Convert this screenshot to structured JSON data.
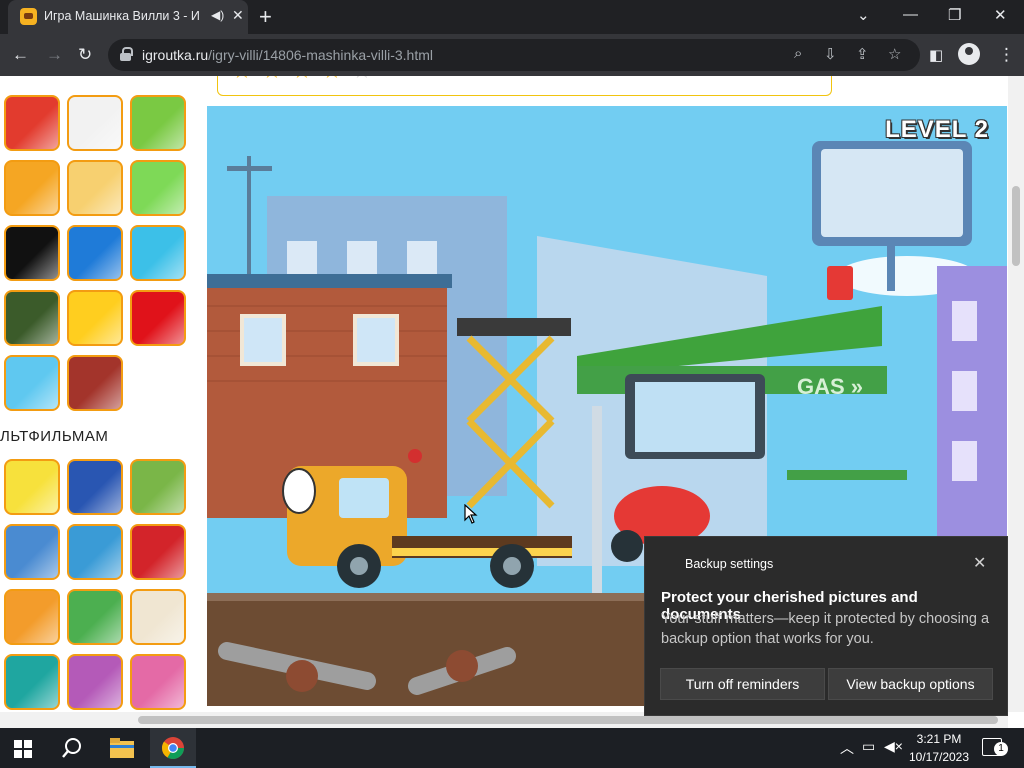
{
  "browser": {
    "tab_title": "Игра Машинка Вилли 3 - И",
    "tab_audio_icon": "speaker-icon",
    "new_tab_label": "+",
    "url_host": "igroutka.ru",
    "url_path": "/igry-villi/14806-mashinka-villi-3.html",
    "window_controls": [
      "tab-search",
      "minimize",
      "restore",
      "close"
    ]
  },
  "sidebar": {
    "section_title": "ЛЬТФИЛЬМАМ",
    "thumbnails_top": [
      {
        "name": "angry-birds",
        "color": "#e23b2e"
      },
      {
        "name": "panda",
        "color": "#f2f2f2"
      },
      {
        "name": "cut-the-rope",
        "color": "#7ac943"
      },
      {
        "name": "chef-hand",
        "color": "#f5a623"
      },
      {
        "name": "adam-and-eve",
        "color": "#f7d070"
      },
      {
        "name": "wheely-car",
        "color": "#7ed957"
      },
      {
        "name": "cartoon-network",
        "color": "#111111"
      },
      {
        "name": "disney-channel",
        "color": "#1f7bd8"
      },
      {
        "name": "gem-match",
        "color": "#3cc0e8"
      },
      {
        "name": "army-soldier",
        "color": "#3b5b2a"
      },
      {
        "name": "brawl-stars",
        "color": "#ffce1f"
      },
      {
        "name": "among-us",
        "color": "#e0121a"
      },
      {
        "name": "pop-it",
        "color": "#5fc8f0"
      },
      {
        "name": "angry-bird-red",
        "color": "#a3342b"
      }
    ],
    "thumbnails_bottom": [
      {
        "name": "spongebob",
        "color": "#f7e13c"
      },
      {
        "name": "sonic",
        "color": "#2956b2"
      },
      {
        "name": "paw-patrol",
        "color": "#7ab648"
      },
      {
        "name": "gravity-falls",
        "color": "#4a8bd1"
      },
      {
        "name": "tom-and-jerry",
        "color": "#3a9bd6"
      },
      {
        "name": "cars-mcqueen",
        "color": "#d3242a"
      },
      {
        "name": "naruto",
        "color": "#f39c2b"
      },
      {
        "name": "scooby-doo",
        "color": "#4caf50"
      },
      {
        "name": "fixiki",
        "color": "#f0e6d2"
      },
      {
        "name": "perry-platypus",
        "color": "#1fa6a0"
      },
      {
        "name": "equestria-girls",
        "color": "#b45ab8"
      },
      {
        "name": "winx",
        "color": "#e46aa6"
      }
    ]
  },
  "game": {
    "level_label": "LEVEL 2",
    "gas_sign": "GAS"
  },
  "notification": {
    "app_name": "Backup settings",
    "title": "Protect your cherished pictures and documents",
    "body": "Your stuff matters—keep it protected by choosing a backup option that works for you.",
    "button_dismiss": "Turn off reminders",
    "button_primary": "View backup options"
  },
  "taskbar": {
    "time": "3:21 PM",
    "date": "10/17/2023",
    "notification_count": "1"
  },
  "colors": {
    "chrome_dark": "#202124",
    "chrome_toolbar": "#35363a",
    "accent_orange": "#f39c12",
    "toast_bg": "#2b2b2b",
    "taskbar_bg": "#1c1f24"
  }
}
